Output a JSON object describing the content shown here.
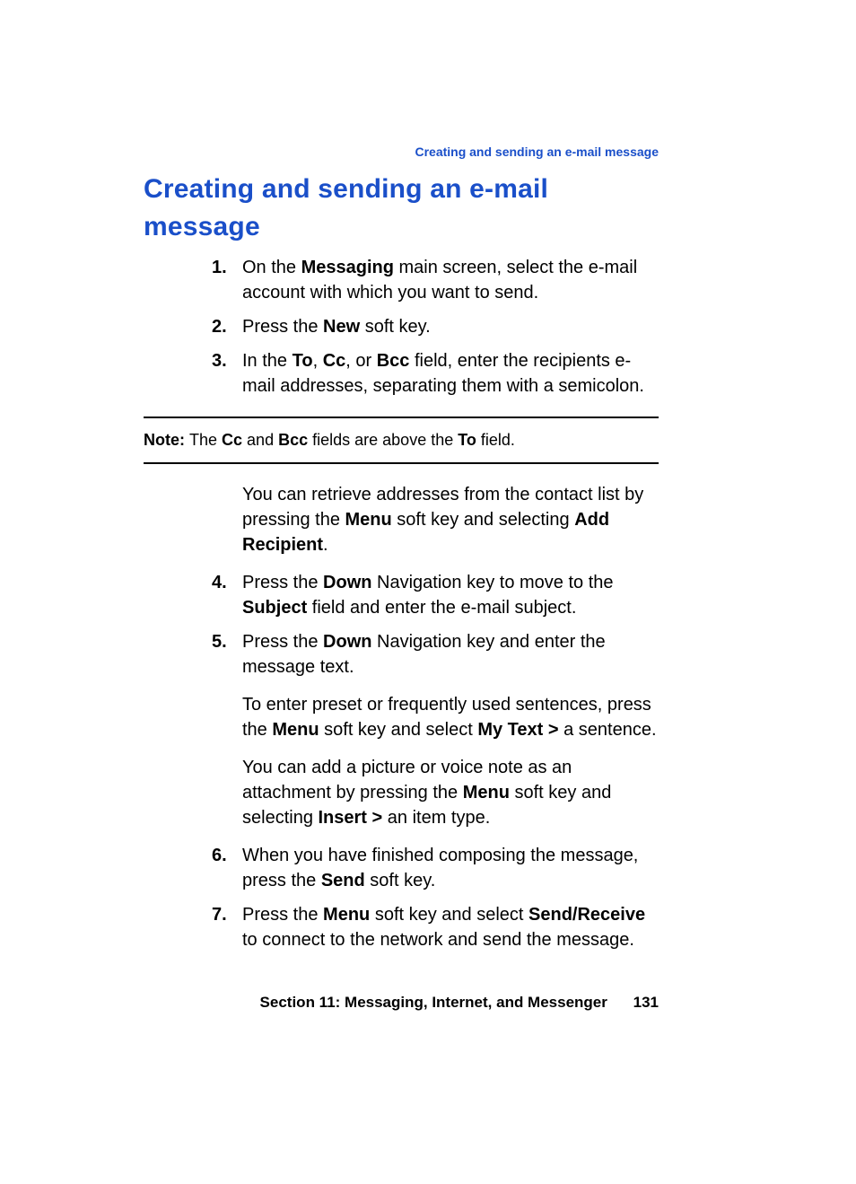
{
  "running_head": "Creating and sending an e-mail message",
  "title": "Creating and sending an e-mail message",
  "steps_a": [
    {
      "num": "1.",
      "segments": [
        "On the ",
        "Messaging",
        " main screen, select the e-mail account with which you want to send."
      ]
    },
    {
      "num": "2.",
      "segments": [
        "Press the ",
        "New",
        " soft key."
      ]
    },
    {
      "num": "3.",
      "segments": [
        "In the ",
        "To",
        ", ",
        "Cc",
        ", or ",
        "Bcc",
        " field, enter the recipients e-mail addresses, separating them with a semicolon."
      ]
    }
  ],
  "note": {
    "label": "Note: ",
    "segments": [
      "The ",
      "Cc",
      " and ",
      "Bcc",
      " fields are above the ",
      "To",
      " field."
    ]
  },
  "para_retrieve": [
    "You can retrieve addresses from the contact list by pressing the ",
    "Menu",
    " soft key and selecting ",
    "Add Recipient",
    "."
  ],
  "steps_b": [
    {
      "num": "4.",
      "segments": [
        "Press the ",
        "Down",
        " Navigation key to move to the ",
        "Subject",
        " field and enter the e-mail subject."
      ]
    },
    {
      "num": "5.",
      "segments": [
        "Press the ",
        "Down",
        " Navigation key and enter the message text."
      ]
    }
  ],
  "para_preset": [
    "To enter preset or frequently used sentences, press the ",
    "Menu",
    " soft key and select ",
    "My Text > ",
    "a sentence."
  ],
  "para_attach": [
    "You can add a picture or voice note as an attachment by pressing the ",
    "Menu",
    " soft key and selecting ",
    "Insert > ",
    "an item type."
  ],
  "steps_c": [
    {
      "num": "6.",
      "segments": [
        "When you have finished composing the message, press the ",
        "Send",
        " soft key."
      ]
    },
    {
      "num": "7.",
      "segments": [
        "Press the ",
        "Menu",
        " soft key and select ",
        "Send/Receive",
        " to connect to the network and send the message."
      ]
    }
  ],
  "footer": {
    "section_label": "Section 11: Messaging, Internet, and Messenger",
    "page_number": "131"
  }
}
